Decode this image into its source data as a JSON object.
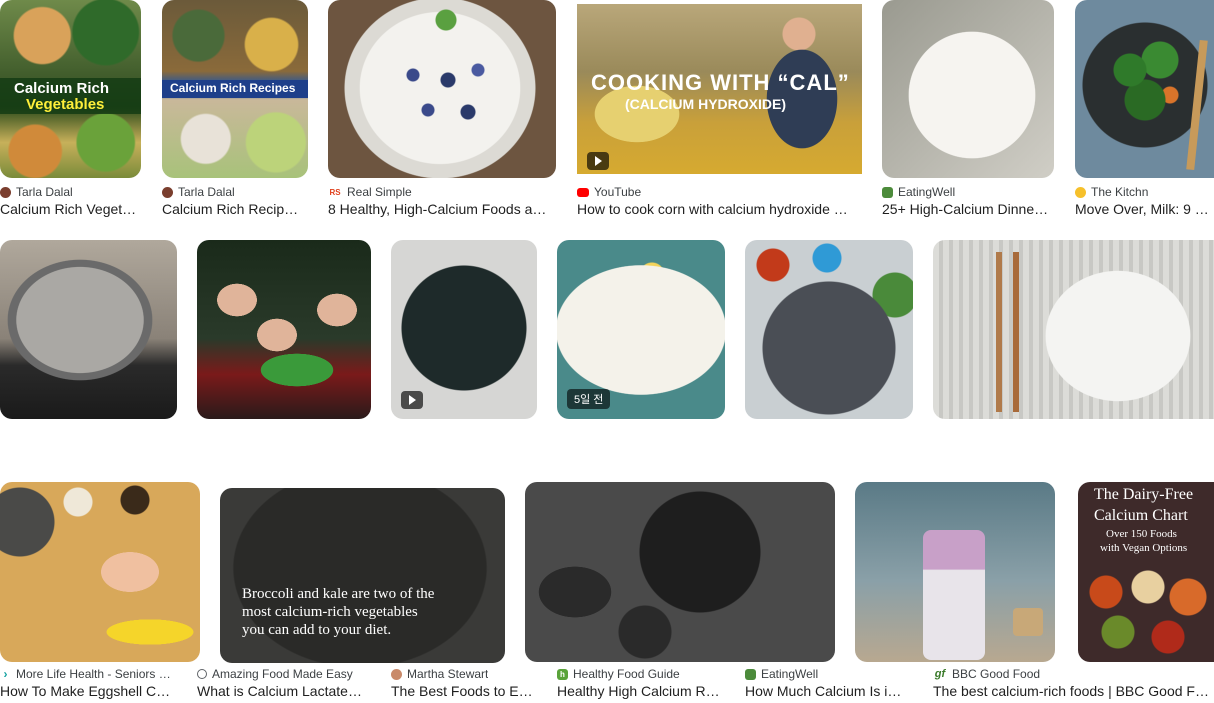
{
  "results": [
    {
      "source": "Tarla Dalal",
      "title": "Calcium Rich Veget…",
      "fav_color": "#7a3e2e",
      "image_text_1": "Calcium Rich",
      "image_text_2": "Vegetables"
    },
    {
      "source": "Tarla Dalal",
      "title": "Calcium Rich Recip…",
      "fav_color": "#7a3e2e",
      "image_text_1": "Calcium Rich Recipes"
    },
    {
      "source": "Real Simple",
      "title": "8 Healthy, High-Calcium Foods a…",
      "fav_color": "#e0401c",
      "fav_text": "RS"
    },
    {
      "source": "YouTube",
      "title": "How to cook corn with calcium hydroxide …",
      "fav_color": "#ff0000",
      "image_text_1": "COOKING WITH “CAL”",
      "image_text_2": "(CALCIUM HYDROXIDE)"
    },
    {
      "source": "EatingWell",
      "title": "25+ High-Calcium Dinne…",
      "fav_color": "#4c8b3b"
    },
    {
      "source": "The Kitchn",
      "title": "Move Over, Milk: 9 …",
      "fav_color": "#f6c02b"
    },
    {
      "source": "More Life Health - Seniors …",
      "title": "How To Make Eggshell C…",
      "fav_color": "#17a3a3"
    },
    {
      "source": "Amazing Food Made Easy",
      "title": "What is Calcium Lactate…",
      "fav_color": "#5f6368"
    },
    {
      "source": "Martha Stewart",
      "title": "The Best Foods to E…",
      "fav_color": "#c98a6a"
    },
    {
      "source": "Healthy Food Guide",
      "title": "Healthy High Calcium R…",
      "fav_color": "#5aa33a",
      "fav_text": "h",
      "badge": "5일 전"
    },
    {
      "source": "EatingWell",
      "title": "How Much Calcium Is i…",
      "fav_color": "#4c8b3b"
    },
    {
      "source": "BBC Good Food",
      "title": "The best calcium-rich foods | BBC Good F…",
      "fav_color": "#ffffff",
      "fav_text": "gf"
    },
    {},
    {
      "image_text_1": "Broccoli and kale are two of the",
      "image_text_2": "most calcium-rich vegetables",
      "image_text_3": "you can add to your diet."
    },
    {},
    {},
    {
      "image_text_1": "The Dairy-Free",
      "image_text_2": "Calcium Chart",
      "image_text_3": "Over 150 Foods",
      "image_text_4": "with Vegan Options"
    }
  ]
}
